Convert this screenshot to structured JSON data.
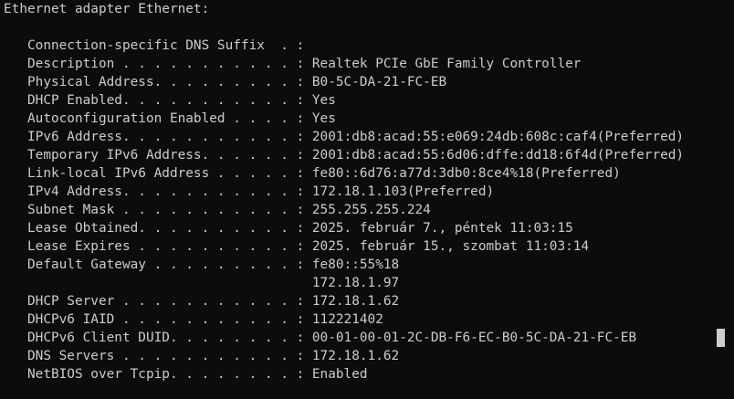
{
  "terminal": {
    "colors": {
      "background": "#0c0c0c",
      "text": "#cccccc",
      "cursor": "#cccccc"
    },
    "lines": [
      "Ethernet adapter Ethernet:",
      "",
      "   Connection-specific DNS Suffix  . :",
      "   Description . . . . . . . . . . . : Realtek PCIe GbE Family Controller",
      "   Physical Address. . . . . . . . . : B0-5C-DA-21-FC-EB",
      "   DHCP Enabled. . . . . . . . . . . : Yes",
      "   Autoconfiguration Enabled . . . . : Yes",
      "   IPv6 Address. . . . . . . . . . . : 2001:db8:acad:55:e069:24db:608c:caf4(Preferred)",
      "   Temporary IPv6 Address. . . . . . : 2001:db8:acad:55:6d06:dffe:dd18:6f4d(Preferred)",
      "   Link-local IPv6 Address . . . . . : fe80::6d76:a77d:3db0:8ce4%18(Preferred)",
      "   IPv4 Address. . . . . . . . . . . : 172.18.1.103(Preferred)",
      "   Subnet Mask . . . . . . . . . . . : 255.255.255.224",
      "   Lease Obtained. . . . . . . . . . : 2025. február 7., péntek 11:03:15",
      "   Lease Expires . . . . . . . . . . : 2025. február 15., szombat 11:03:14",
      "   Default Gateway . . . . . . . . . : fe80::55%18",
      "                                       172.18.1.97",
      "   DHCP Server . . . . . . . . . . . : 172.18.1.62",
      "   DHCPv6 IAID . . . . . . . . . . . : 112221402",
      "   DHCPv6 Client DUID. . . . . . . . : 00-01-00-01-2C-DB-F6-EC-B0-5C-DA-21-FC-EB",
      "   DNS Servers . . . . . . . . . . . : 172.18.1.62",
      "   NetBIOS over Tcpip. . . . . . . . : Enabled"
    ]
  }
}
